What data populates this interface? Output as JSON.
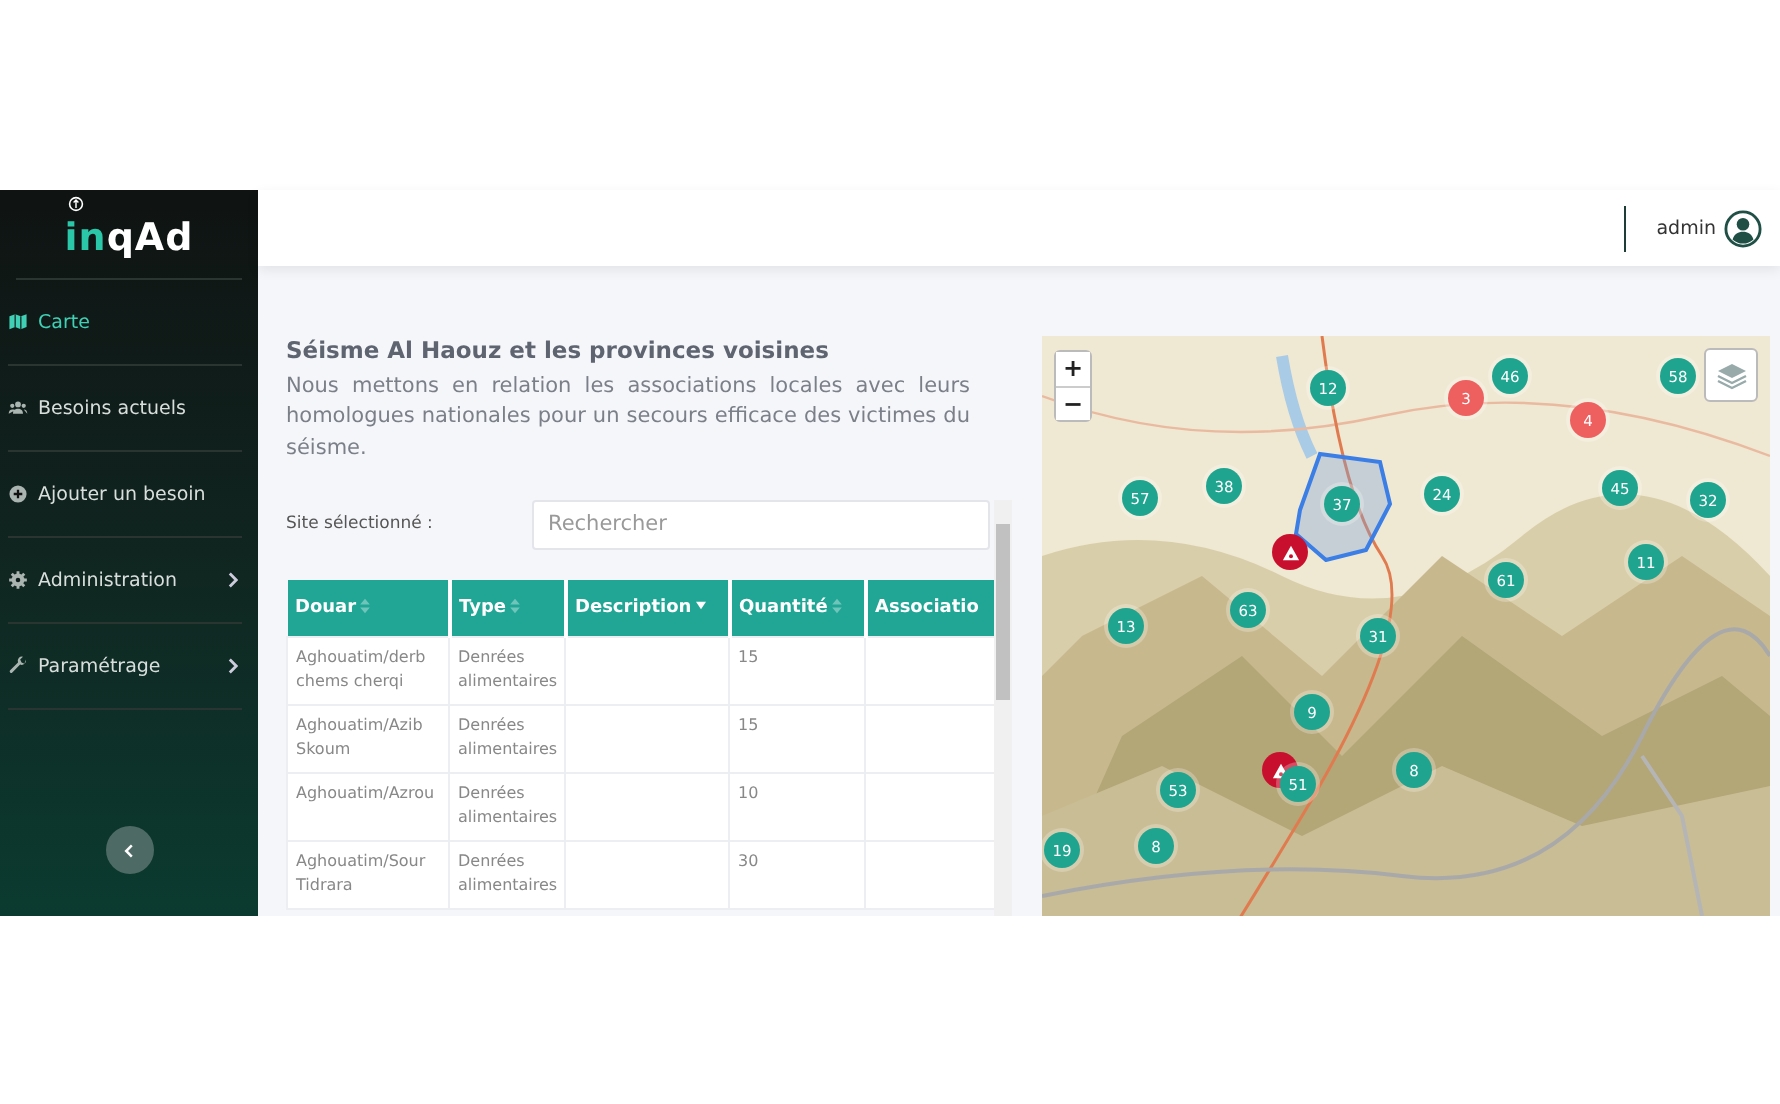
{
  "sidebar": {
    "logo": {
      "lead": "in",
      "rest": "qAd"
    },
    "items": [
      {
        "label": "Carte",
        "selected": true,
        "submenu": false
      },
      {
        "label": "Besoins actuels",
        "selected": false,
        "submenu": false
      },
      {
        "label": "Ajouter un besoin",
        "selected": false,
        "submenu": false
      },
      {
        "label": "Administration",
        "selected": false,
        "submenu": true
      },
      {
        "label": "Paramétrage",
        "selected": false,
        "submenu": true
      }
    ]
  },
  "header": {
    "user": "admin"
  },
  "intro": {
    "title": "Séisme Al Haouz et les provinces voisines",
    "text": "Nous mettons en relation les associations locales avec leurs homologues nationales pour un secours efficace des victimes du séisme."
  },
  "filter": {
    "label": "Site sélectionné :",
    "search_placeholder": "Rechercher"
  },
  "table": {
    "columns": [
      {
        "label": "Douar",
        "sorted": false
      },
      {
        "label": "Type",
        "sorted": false
      },
      {
        "label": "Description",
        "sorted": true
      },
      {
        "label": "Quantité",
        "sorted": false
      },
      {
        "label": "Associatio"
      }
    ],
    "rows": [
      [
        "Aghouatim/derb chems cherqi",
        "Denrées alimentaires",
        "",
        "15",
        ""
      ],
      [
        "Aghouatim/Azib Skoum",
        "Denrées alimentaires",
        "",
        "15",
        ""
      ],
      [
        "Aghouatim/Azrou",
        "Denrées alimentaires",
        "",
        "10",
        ""
      ],
      [
        "Aghouatim/Sour Tidrara",
        "Denrées alimentaires",
        "",
        "30",
        ""
      ]
    ]
  },
  "map": {
    "zoom_in": "+",
    "zoom_out": "−",
    "markers": [
      {
        "kind": "cluster",
        "count": "12",
        "color": "#1fa58f"
      },
      {
        "kind": "cluster",
        "count": "3",
        "color": "#ee5f5f"
      },
      {
        "kind": "cluster",
        "count": "46",
        "color": "#1fa58f"
      },
      {
        "kind": "cluster",
        "count": "58",
        "color": "#1fa58f"
      },
      {
        "kind": "cluster",
        "count": "4",
        "color": "#ee5f5f"
      },
      {
        "kind": "cluster",
        "count": "57",
        "color": "#1fa58f"
      },
      {
        "kind": "cluster",
        "count": "38",
        "color": "#1fa58f"
      },
      {
        "kind": "cluster",
        "count": "37",
        "color": "#1fa58f"
      },
      {
        "kind": "cluster",
        "count": "24",
        "color": "#1fa58f"
      },
      {
        "kind": "cluster",
        "count": "45",
        "color": "#1fa58f"
      },
      {
        "kind": "cluster",
        "count": "32",
        "color": "#1fa58f"
      },
      {
        "kind": "cluster",
        "count": "11",
        "color": "#1fa58f"
      },
      {
        "kind": "cluster",
        "count": "61",
        "color": "#1fa58f"
      },
      {
        "kind": "cluster",
        "count": "13",
        "color": "#1fa58f"
      },
      {
        "kind": "cluster",
        "count": "63",
        "color": "#1fa58f"
      },
      {
        "kind": "cluster",
        "count": "31",
        "color": "#1fa58f"
      },
      {
        "kind": "cluster",
        "count": "9",
        "color": "#1fa58f"
      },
      {
        "kind": "cluster",
        "count": "8",
        "color": "#1fa58f"
      },
      {
        "kind": "cluster",
        "count": "53",
        "color": "#1fa58f"
      },
      {
        "kind": "alert",
        "color": "#c8102e"
      },
      {
        "kind": "alert",
        "color": "#c8102e"
      },
      {
        "kind": "cluster",
        "count": "51",
        "color": "#1fa58f"
      },
      {
        "kind": "cluster",
        "count": "19",
        "color": "#1fa58f"
      },
      {
        "kind": "cluster",
        "count": "8",
        "color": "#1fa58f"
      }
    ]
  }
}
